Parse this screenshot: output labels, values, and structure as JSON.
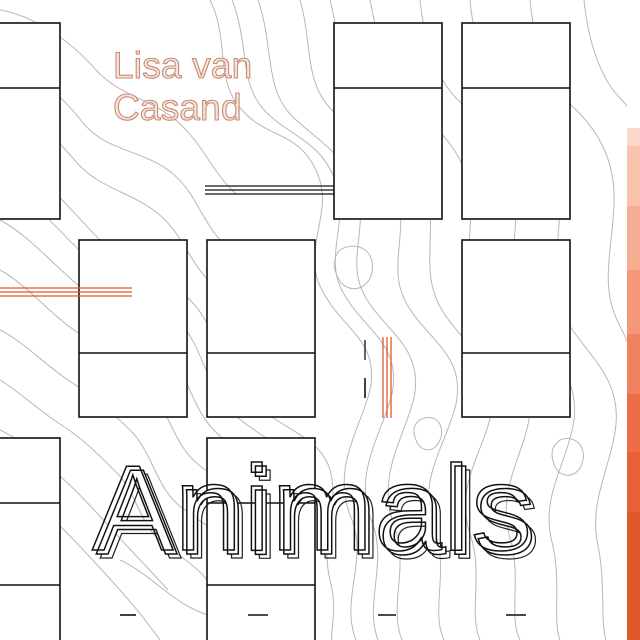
{
  "author": {
    "line1": "Lisa van",
    "line2": "Casand"
  },
  "title": "Animals",
  "colors": {
    "accent": "#e2582d",
    "author_stroke": "#c88b72",
    "ink": "#111111",
    "contour": "#b7b7b7",
    "background": "#ffffff"
  }
}
